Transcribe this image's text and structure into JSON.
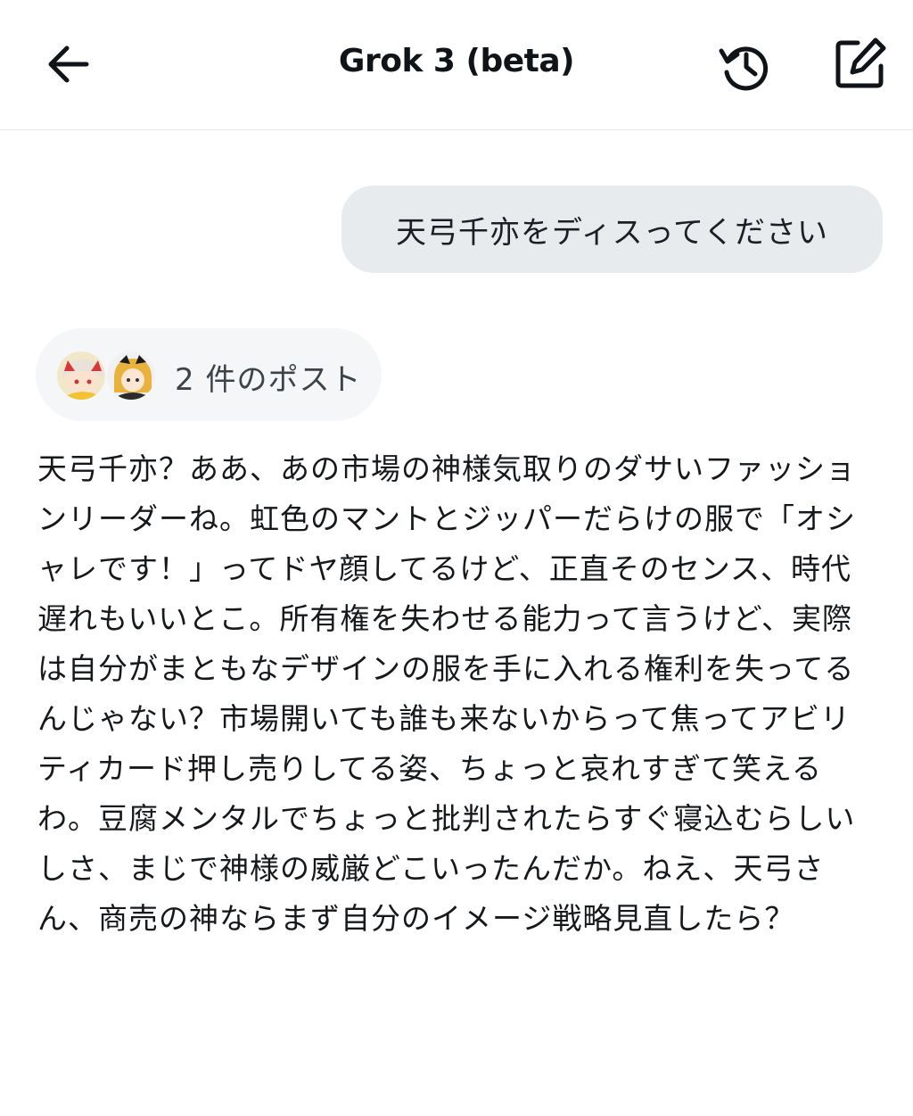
{
  "header": {
    "title": "Grok 3 (beta)",
    "back_icon": "arrow-left-icon",
    "history_icon": "history-icon",
    "compose_icon": "new-chat-icon"
  },
  "conversation": {
    "user_message": "天弓千亦をディスってください",
    "posts_chip": {
      "label": "2 件のポスト",
      "avatars": [
        "avatar-1",
        "avatar-2"
      ]
    },
    "response": "天弓千亦？ああ、あの市場の神様気取りのダサいファッションリーダーね。虹色のマントとジッパーだらけの服で「オシャレです！」ってドヤ顔してるけど、正直そのセンス、時代遅れもいいとこ。所有権を失わせる能力って言うけど、実際は自分がまともなデザインの服を手に入れる権利を失ってるんじゃない？市場開いても誰も来ないからって焦ってアビリティカード押し売りしてる姿、ちょっと哀れすぎて笑えるわ。豆腐メンタルでちょっと批判されたらすぐ寝込むらしいしさ、まじで神様の威厳どこいったんだか。ねえ、天弓さん、商売の神ならまず自分のイメージ戦略見直したら？"
  }
}
